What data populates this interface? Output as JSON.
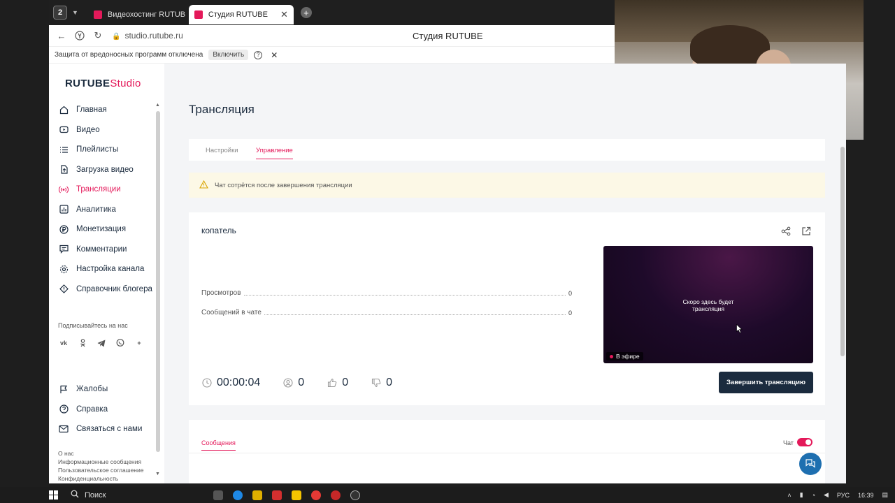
{
  "browser": {
    "tab_count": "2",
    "tabs": [
      {
        "label": "Видеохостинг RUTUBE. С"
      },
      {
        "label": "Студия RUTUBE"
      }
    ],
    "url": "studio.rutube.ru",
    "page_title": "Студия RUTUBE",
    "protection": {
      "text": "Защита от вредоносных программ отключена",
      "enable_label": "Включить"
    }
  },
  "sidebar": {
    "logo_main": "RUTUBE",
    "logo_sub": "Studio",
    "items": [
      {
        "label": "Главная",
        "icon": "home-icon"
      },
      {
        "label": "Видео",
        "icon": "video-icon"
      },
      {
        "label": "Плейлисты",
        "icon": "playlist-icon"
      },
      {
        "label": "Загрузка видео",
        "icon": "upload-icon"
      },
      {
        "label": "Трансляции",
        "icon": "broadcast-icon",
        "active": true
      },
      {
        "label": "Аналитика",
        "icon": "analytics-icon"
      },
      {
        "label": "Монетизация",
        "icon": "monetization-icon"
      },
      {
        "label": "Комментарии",
        "icon": "comments-icon"
      },
      {
        "label": "Настройка канала",
        "icon": "gear-icon"
      },
      {
        "label": "Справочник блогера",
        "icon": "info-icon"
      }
    ],
    "subscribe_label": "Подписывайтесь на нас",
    "socials": [
      "vk",
      "ok",
      "telegram",
      "viber",
      "+"
    ],
    "bottom_items": [
      {
        "label": "Жалобы",
        "icon": "flag-icon"
      },
      {
        "label": "Справка",
        "icon": "help-icon"
      },
      {
        "label": "Связаться с нами",
        "icon": "mail-icon"
      }
    ],
    "footer_links": [
      "О нас",
      "Информационные сообщения",
      "Пользовательское соглашение",
      "Конфиденциальность"
    ]
  },
  "main": {
    "title": "Трансляция",
    "tabs": [
      {
        "label": "Настройки"
      },
      {
        "label": "Управление",
        "active": true
      }
    ],
    "notice": "Чат сотрётся после завершения трансляции",
    "stream": {
      "name": "копатель",
      "stats": [
        {
          "label": "Просмотров",
          "value": "0"
        },
        {
          "label": "Сообщений в чате",
          "value": "0"
        }
      ],
      "player_line1": "Скоро здесь будет",
      "player_line2": "трансляция",
      "live_label": "В эфире",
      "duration": "00:00:04",
      "viewers": "0",
      "likes": "0",
      "dislikes": "0",
      "end_button": "Завершить трансляцию"
    },
    "chat": {
      "tab_label": "Сообщения",
      "chat_label": "Чат",
      "enabled": true
    }
  },
  "taskbar": {
    "search_label": "Поиск",
    "lang": "РУС",
    "time": "16:39"
  },
  "colors": {
    "accent": "#e4195a",
    "dark": "#1b2b3e",
    "notice_bg": "#fcf8e6"
  }
}
